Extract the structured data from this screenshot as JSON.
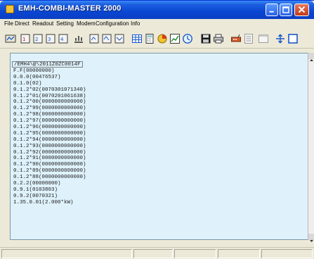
{
  "window": {
    "title": "EMH-COMBI-MASTER 2000",
    "title_color": "#ffffff",
    "titlebar_color": "#0a46d2"
  },
  "menu": [
    "File",
    "Direct",
    "Readout",
    "Setting",
    "Modem",
    "Configuration",
    "Info"
  ],
  "toolbar": {
    "buttons": [
      "readout-icon",
      "meter-1-icon",
      "meter-2-icon",
      "meter-3-icon",
      "meter-4-icon",
      "signal-icon",
      "meter-5-icon",
      "meter-6-icon",
      "meter-7-icon",
      "table-icon",
      "calc-icon",
      "chart-icon",
      "graph-icon",
      "clock-icon",
      "save-icon",
      "print-icon",
      "modem-icon",
      "list-icon",
      "window-icon",
      "arrow-icon",
      "frame-icon"
    ]
  },
  "editor": {
    "background": "#dff2fb",
    "lines": [
      "/EMH4\\@\\2011Z0ZC0014F",
      "F.F(00000000)",
      "0.0.0(00476537)",
      "0.1.0(02)",
      "0.1.2*02(0070301071340)",
      "0.1.2*01(0070201061638)",
      "0.1.2*00(0000000000000)",
      "0.1.2*99(0000000000000)",
      "0.1.2*98(0000000000000)",
      "0.1.2*97(0000000000000)",
      "0.1.2*96(0000000000000)",
      "0.1.2*95(0000000000000)",
      "0.1.2*94(0000000000000)",
      "0.1.2*93(0000000000000)",
      "0.1.2*92(0000000000000)",
      "0.1.2*91(0000000000000)",
      "0.1.2*90(0000000000000)",
      "0.1.2*89(0000000000000)",
      "0.1.2*88(0000000000000)",
      "0.2.2(00000000)",
      "0.9.1(0103803)",
      "0.9.2(0070321)",
      "1.35.0.01(2.000*kW)"
    ]
  },
  "status": {
    "cells": [
      "",
      "",
      "",
      "",
      ""
    ]
  }
}
